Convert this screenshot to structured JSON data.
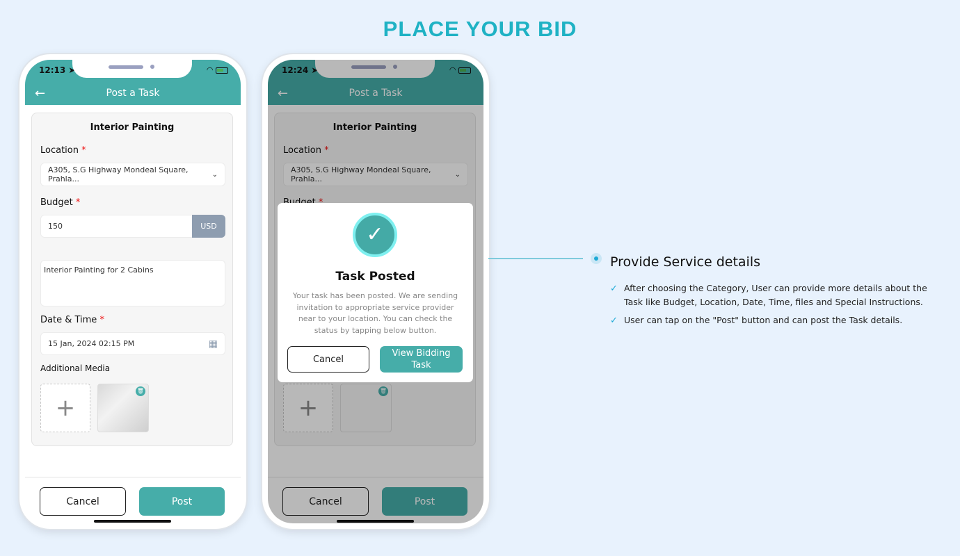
{
  "hero_title": "PLACE YOUR BID",
  "phones": [
    {
      "time": "12:13",
      "header_title": "Post a Task"
    },
    {
      "time": "12:24",
      "header_title": "Post a Task"
    }
  ],
  "form": {
    "category": "Interior Painting",
    "location_label": "Location",
    "location_value": "A305, S.G Highway Mondeal Square, Prahla...",
    "budget_label": "Budget",
    "budget_value": "150",
    "currency": "USD",
    "description": "Interior Painting for 2 Cabins",
    "date_label": "Date & Time",
    "date_value": "15 Jan, 2024 02:15 PM",
    "media_label": "Additional Media",
    "required_mark": "*",
    "add_glyph": "+",
    "cancel_label": "Cancel",
    "post_label": "Post"
  },
  "modal": {
    "title": "Task Posted",
    "body": "Your task has been posted. We are sending invitation to appropriate service provider near to your location.  You can check the status by tapping below button.",
    "cancel_label": "Cancel",
    "view_label": "View Bidding Task"
  },
  "panel": {
    "title": "Provide Service details",
    "bullets": [
      "After choosing the Category, User can provide more details about the Task like Budget, Location, Date, Time, files and Special Instructions.",
      "User can tap on the \"Post\" button and can post the Task details."
    ]
  },
  "colors": {
    "accent": "#46ada9",
    "hero": "#1fb2c4",
    "background": "#e8f2fd",
    "required": "#ee1111"
  },
  "icons": [
    "back-arrow-icon",
    "location-arrow-icon",
    "wifi-icon",
    "battery-icon",
    "chevron-down-icon",
    "calendar-icon",
    "plus-icon",
    "trash-icon",
    "checkmark-icon",
    "check-circle-icon"
  ]
}
